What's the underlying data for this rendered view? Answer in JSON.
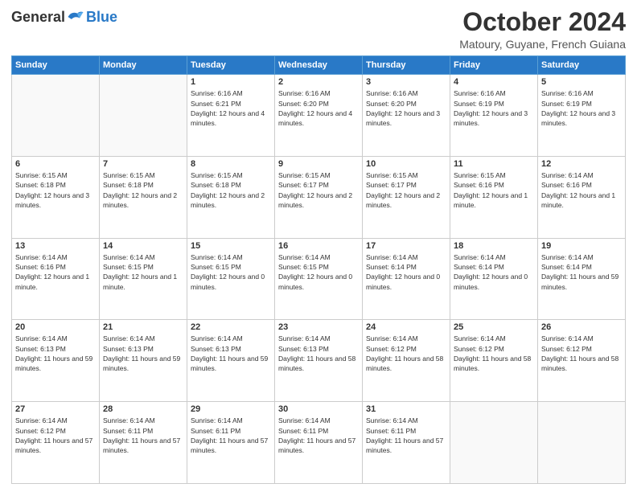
{
  "header": {
    "logo_general": "General",
    "logo_blue": "Blue",
    "month_title": "October 2024",
    "location": "Matoury, Guyane, French Guiana"
  },
  "weekdays": [
    "Sunday",
    "Monday",
    "Tuesday",
    "Wednesday",
    "Thursday",
    "Friday",
    "Saturday"
  ],
  "weeks": [
    [
      {
        "day": "",
        "info": ""
      },
      {
        "day": "",
        "info": ""
      },
      {
        "day": "1",
        "info": "Sunrise: 6:16 AM\nSunset: 6:21 PM\nDaylight: 12 hours and 4 minutes."
      },
      {
        "day": "2",
        "info": "Sunrise: 6:16 AM\nSunset: 6:20 PM\nDaylight: 12 hours and 4 minutes."
      },
      {
        "day": "3",
        "info": "Sunrise: 6:16 AM\nSunset: 6:20 PM\nDaylight: 12 hours and 3 minutes."
      },
      {
        "day": "4",
        "info": "Sunrise: 6:16 AM\nSunset: 6:19 PM\nDaylight: 12 hours and 3 minutes."
      },
      {
        "day": "5",
        "info": "Sunrise: 6:16 AM\nSunset: 6:19 PM\nDaylight: 12 hours and 3 minutes."
      }
    ],
    [
      {
        "day": "6",
        "info": "Sunrise: 6:15 AM\nSunset: 6:18 PM\nDaylight: 12 hours and 3 minutes."
      },
      {
        "day": "7",
        "info": "Sunrise: 6:15 AM\nSunset: 6:18 PM\nDaylight: 12 hours and 2 minutes."
      },
      {
        "day": "8",
        "info": "Sunrise: 6:15 AM\nSunset: 6:18 PM\nDaylight: 12 hours and 2 minutes."
      },
      {
        "day": "9",
        "info": "Sunrise: 6:15 AM\nSunset: 6:17 PM\nDaylight: 12 hours and 2 minutes."
      },
      {
        "day": "10",
        "info": "Sunrise: 6:15 AM\nSunset: 6:17 PM\nDaylight: 12 hours and 2 minutes."
      },
      {
        "day": "11",
        "info": "Sunrise: 6:15 AM\nSunset: 6:16 PM\nDaylight: 12 hours and 1 minute."
      },
      {
        "day": "12",
        "info": "Sunrise: 6:14 AM\nSunset: 6:16 PM\nDaylight: 12 hours and 1 minute."
      }
    ],
    [
      {
        "day": "13",
        "info": "Sunrise: 6:14 AM\nSunset: 6:16 PM\nDaylight: 12 hours and 1 minute."
      },
      {
        "day": "14",
        "info": "Sunrise: 6:14 AM\nSunset: 6:15 PM\nDaylight: 12 hours and 1 minute."
      },
      {
        "day": "15",
        "info": "Sunrise: 6:14 AM\nSunset: 6:15 PM\nDaylight: 12 hours and 0 minutes."
      },
      {
        "day": "16",
        "info": "Sunrise: 6:14 AM\nSunset: 6:15 PM\nDaylight: 12 hours and 0 minutes."
      },
      {
        "day": "17",
        "info": "Sunrise: 6:14 AM\nSunset: 6:14 PM\nDaylight: 12 hours and 0 minutes."
      },
      {
        "day": "18",
        "info": "Sunrise: 6:14 AM\nSunset: 6:14 PM\nDaylight: 12 hours and 0 minutes."
      },
      {
        "day": "19",
        "info": "Sunrise: 6:14 AM\nSunset: 6:14 PM\nDaylight: 11 hours and 59 minutes."
      }
    ],
    [
      {
        "day": "20",
        "info": "Sunrise: 6:14 AM\nSunset: 6:13 PM\nDaylight: 11 hours and 59 minutes."
      },
      {
        "day": "21",
        "info": "Sunrise: 6:14 AM\nSunset: 6:13 PM\nDaylight: 11 hours and 59 minutes."
      },
      {
        "day": "22",
        "info": "Sunrise: 6:14 AM\nSunset: 6:13 PM\nDaylight: 11 hours and 59 minutes."
      },
      {
        "day": "23",
        "info": "Sunrise: 6:14 AM\nSunset: 6:13 PM\nDaylight: 11 hours and 58 minutes."
      },
      {
        "day": "24",
        "info": "Sunrise: 6:14 AM\nSunset: 6:12 PM\nDaylight: 11 hours and 58 minutes."
      },
      {
        "day": "25",
        "info": "Sunrise: 6:14 AM\nSunset: 6:12 PM\nDaylight: 11 hours and 58 minutes."
      },
      {
        "day": "26",
        "info": "Sunrise: 6:14 AM\nSunset: 6:12 PM\nDaylight: 11 hours and 58 minutes."
      }
    ],
    [
      {
        "day": "27",
        "info": "Sunrise: 6:14 AM\nSunset: 6:12 PM\nDaylight: 11 hours and 57 minutes."
      },
      {
        "day": "28",
        "info": "Sunrise: 6:14 AM\nSunset: 6:11 PM\nDaylight: 11 hours and 57 minutes."
      },
      {
        "day": "29",
        "info": "Sunrise: 6:14 AM\nSunset: 6:11 PM\nDaylight: 11 hours and 57 minutes."
      },
      {
        "day": "30",
        "info": "Sunrise: 6:14 AM\nSunset: 6:11 PM\nDaylight: 11 hours and 57 minutes."
      },
      {
        "day": "31",
        "info": "Sunrise: 6:14 AM\nSunset: 6:11 PM\nDaylight: 11 hours and 57 minutes."
      },
      {
        "day": "",
        "info": ""
      },
      {
        "day": "",
        "info": ""
      }
    ]
  ]
}
